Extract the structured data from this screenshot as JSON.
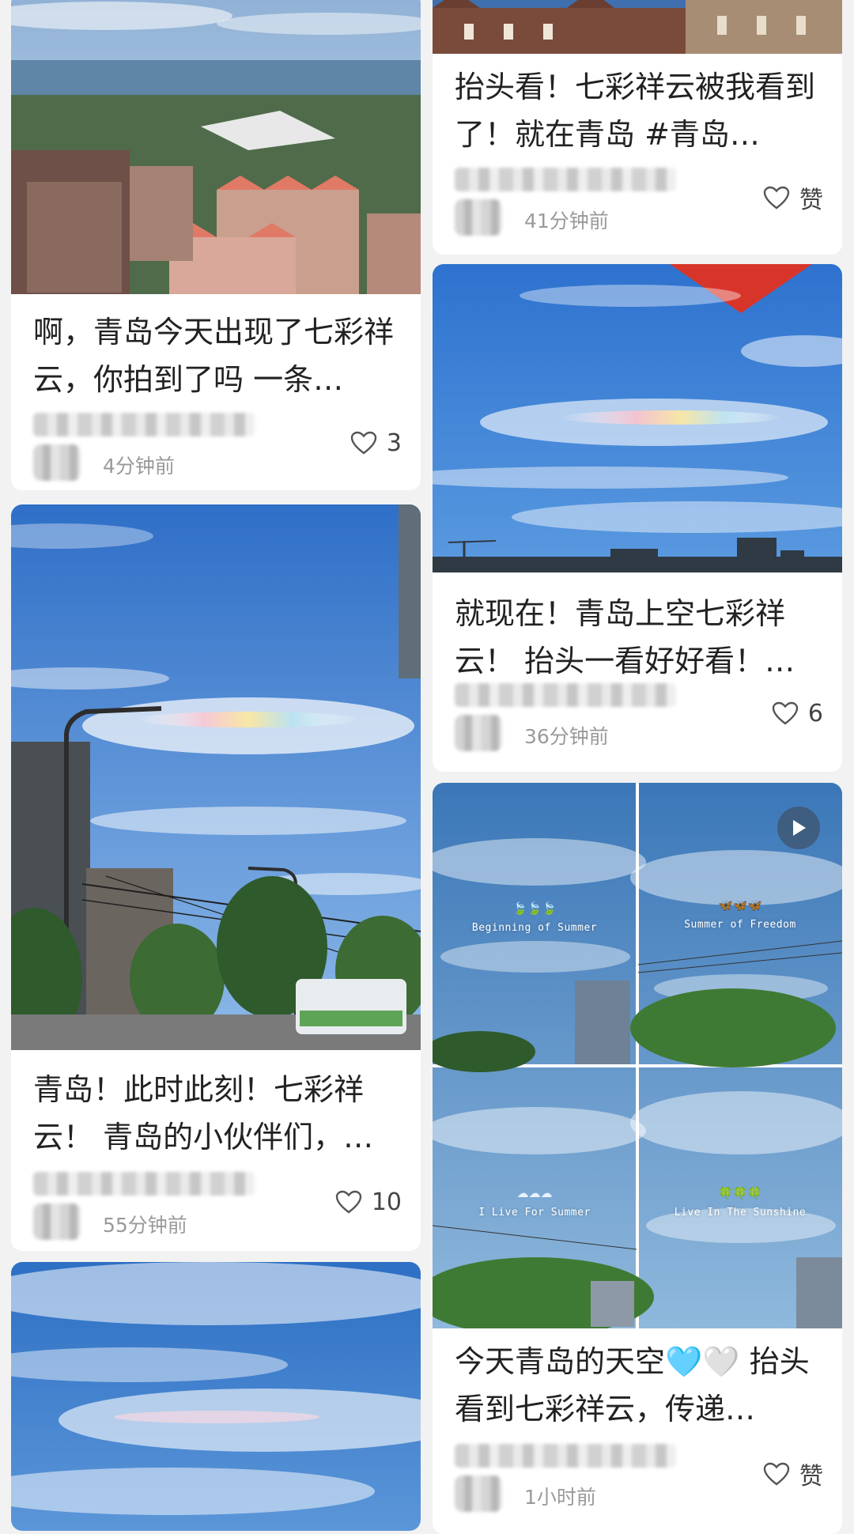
{
  "feed": {
    "left": [
      {
        "title": "啊，青岛今天出现了七彩祥云，你拍到了吗 一条…",
        "time": "4分钟前",
        "likes": "3",
        "photo": "coastal-city-view"
      },
      {
        "title": "青岛！此时此刻！七彩祥云！ 青岛的小伙伴们，…",
        "time": "55分钟前",
        "likes": "10",
        "photo": "street-sky-iridescent-cloud"
      },
      {
        "photo": "sky-clouds"
      }
    ],
    "right": [
      {
        "title": "抬头看！七彩祥云被我看到了！就在青岛 #青岛…",
        "time": "41分钟前",
        "likes": "赞",
        "photo": "buildings-top"
      },
      {
        "title": "就现在！青岛上空七彩祥云！ 抬头一看好好看！…",
        "time": "36分钟前",
        "likes": "6",
        "photo": "blue-sky-iridescent-cloud"
      },
      {
        "title": "今天青岛的天空🩵🤍 抬头看到七彩祥云，传递…",
        "time": "1小时前",
        "likes": "赞",
        "photo": "sky-collage",
        "collage_captions": [
          "Beginning of Summer",
          "Summer of Freedom",
          "I Live For Summer",
          "Live In The Sunshine"
        ],
        "collage_emojis": [
          "🍃🍃🍃",
          "🦋🦋🦋",
          "☁☁☁",
          "🍀🍀🍀"
        ]
      }
    ]
  },
  "icons": {
    "like": "heart-outline-icon",
    "video": "play-icon"
  },
  "colors": {
    "background": "#f2f2f2",
    "card": "#ffffff",
    "sky": "#3a7fd4",
    "meta_text": "#9a9a9a"
  }
}
